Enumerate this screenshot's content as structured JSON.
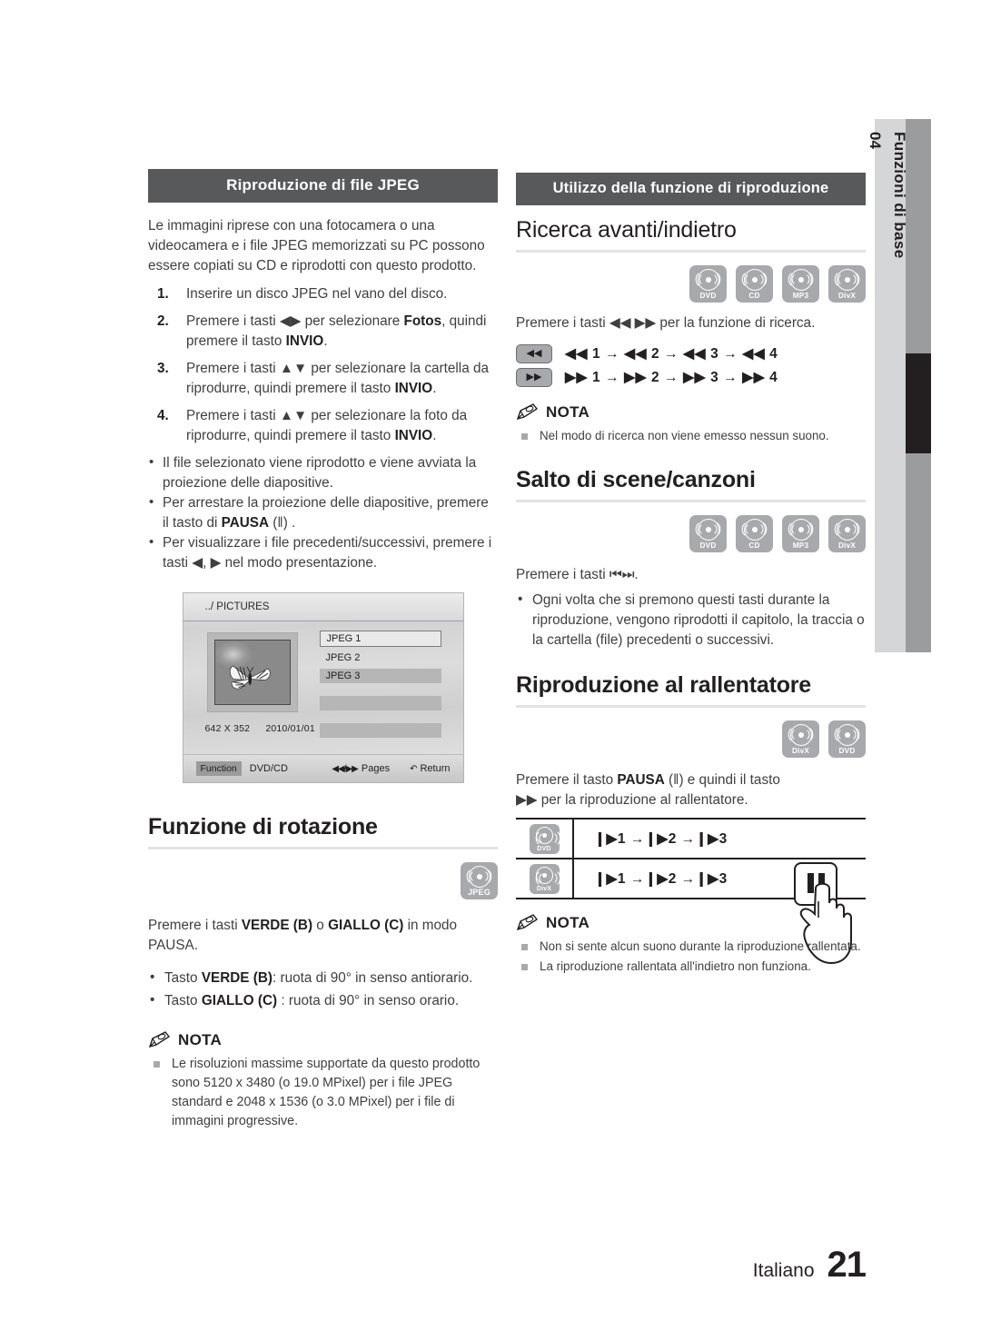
{
  "side_tab": {
    "chapter_number": "04",
    "chapter_title": "Funzioni di base"
  },
  "left_column": {
    "section_bar": "Riproduzione di file JPEG",
    "intro": "Le immagini riprese con una fotocamera o una videocamera e i file JPEG memorizzati su PC possono essere copiati su CD e riprodotti con questo prodotto.",
    "steps": [
      {
        "num": "1.",
        "html": "Inserire un disco JPEG nel vano del disco."
      },
      {
        "num": "2.",
        "html": "Premere i tasti ◀▶ per selezionare <b>Fotos</b>, quindi premere il tasto <b>INVIO</b>."
      },
      {
        "num": "3.",
        "html": "Premere i tasti ▲▼ per selezionare la cartella da riprodurre, quindi premere il tasto <b>INVIO</b>."
      },
      {
        "num": "4.",
        "html": "Premere i tasti ▲▼ per selezionare la foto da riprodurre, quindi premere il tasto <b>INVIO</b>."
      }
    ],
    "sub_bullets": [
      "Il file selezionato viene riprodotto e viene avviata la proiezione delle diapositive.",
      "Per arrestare la proiezione delle diapositive, premere il tasto di <b>PAUSA</b> (‖) .",
      "Per visualizzare i file precedenti/successivi, premere i tasti ◀, ▶ nel modo presentazione."
    ],
    "osd": {
      "path": "../ PICTURES",
      "files": [
        "JPEG 1",
        "JPEG 2",
        "JPEG 3"
      ],
      "resolution": "642 X 352",
      "date": "2010/01/01",
      "function_label": "Function",
      "source_label": "DVD/CD",
      "pages_label": "Pages",
      "return_label": "Return"
    },
    "rotation": {
      "heading": "Funzione di rotazione",
      "badge": "JPEG",
      "instruction": "Premere i tasti <b>VERDE (B)</b> o <b>GIALLO (C)</b> in modo PAUSA.",
      "bullets": [
        "Tasto <b>VERDE (B)</b>: ruota di 90° in senso antiorario.",
        "Tasto <b>GIALLO (C)</b> : ruota di 90° in senso orario."
      ],
      "nota_title": "NOTA",
      "nota_items": [
        "Le risoluzioni massime supportate da questo prodotto sono 5120 x 3480 (o 19.0 MPixel) per i file JPEG standard e 2048 x 1536 (o 3.0 MPixel) per i file di immagini progressive."
      ]
    }
  },
  "right_column": {
    "section_bar": "Utilizzo della funzione di riproduzione",
    "search": {
      "heading": "Ricerca avanti/indietro",
      "badges": [
        "DVD",
        "CD",
        "MP3",
        "DivX"
      ],
      "instruction": "Premere i tasti ◀◀ ▶▶ per la funzione di ricerca.",
      "key_rows": [
        {
          "key": "◀◀",
          "sequence": "◀◀ 1 → ◀◀ 2 → ◀◀ 3 → ◀◀ 4"
        },
        {
          "key": "▶▶",
          "sequence": "▶▶ 1 → ▶▶ 2 → ▶▶ 3 → ▶▶ 4"
        }
      ],
      "nota_title": "NOTA",
      "nota_items": [
        "Nel modo di ricerca non viene emesso nessun suono."
      ]
    },
    "skip": {
      "heading": "Salto di scene/canzoni",
      "badges": [
        "DVD",
        "CD",
        "MP3",
        "DivX"
      ],
      "instruction": "Premere i tasti ⏮⏭.",
      "bullets": [
        "Ogni volta che si premono questi tasti durante la riproduzione, vengono riprodotti il capitolo, la traccia o la cartella (file) precedenti o successivi."
      ]
    },
    "slow": {
      "heading": "Riproduzione al rallentatore",
      "badges": [
        "DivX",
        "DVD"
      ],
      "instruction": "Premere il tasto <b>PAUSA</b> (‖) e quindi il tasto ▶▶ per la riproduzione al rallentatore.",
      "table": [
        {
          "badge": "DVD",
          "sequence": "❙▶1 →❙▶2 →❙▶3"
        },
        {
          "badge": "DivX",
          "sequence": "❙▶1 →❙▶2 →❙▶3"
        }
      ],
      "nota_title": "NOTA",
      "nota_items": [
        "Non si sente alcun suono durante la riproduzione rallentata.",
        "La riproduzione rallentata all'indietro non funziona."
      ]
    }
  },
  "footer": {
    "language": "Italiano",
    "page_number": "21"
  },
  "colors": {
    "bar_header_bg": "#58595b",
    "badge_bg": "#a7a9ac",
    "side_tab_bg": "#d4d6d8",
    "side_bar": "#9a9c9e",
    "side_bar_active": "#231f20",
    "text": "#231f20"
  }
}
